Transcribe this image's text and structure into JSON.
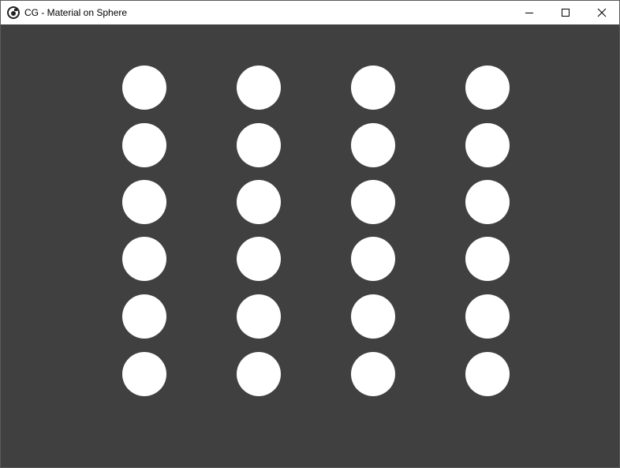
{
  "window": {
    "title": "CG - Material on Sphere",
    "icon": "app-logo-icon",
    "controls": [
      "minimize-icon",
      "maximize-icon",
      "close-icon"
    ]
  },
  "scene": {
    "background_color": "#404040",
    "sphere_color": "#ffffff",
    "rows": 6,
    "columns": 4
  }
}
